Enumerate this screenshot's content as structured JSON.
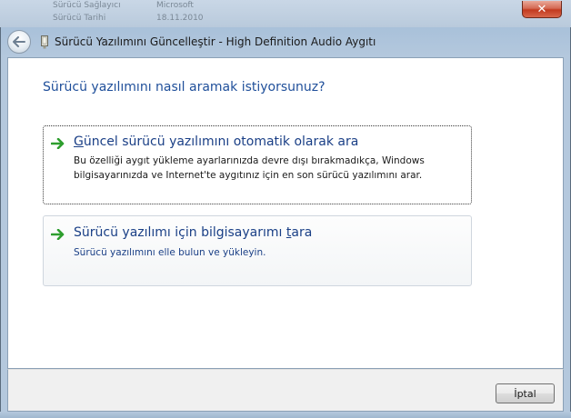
{
  "window": {
    "title": "Sürücü Yazılımını Güncelleştir - High Definition Audio Aygıtı",
    "close_symbol": "✕"
  },
  "background_window": {
    "rows": [
      {
        "label": "Sürücü Sağlayıcı",
        "value": "Microsoft"
      },
      {
        "label": "Sürücü Tarihi",
        "value": "18.11.2010"
      }
    ]
  },
  "main": {
    "heading": "Sürücü yazılımını nasıl aramak istiyorsunuz?",
    "options": [
      {
        "title_before": "",
        "title_accel": "G",
        "title_after": "üncel sürücü yazılımını otomatik olarak ara",
        "description": "Bu özelliği aygıt yükleme ayarlarınızda devre dışı bırakmadıkça, Windows bilgisayarınızda ve Internet'te aygıtınız için en son sürücü yazılımını arar."
      },
      {
        "title_before": "Sürücü yazılımı için bilgisayarımı ",
        "title_accel": "t",
        "title_after": "ara",
        "description": "Sürücü yazılımını elle bulun ve yükleyin."
      }
    ]
  },
  "footer": {
    "cancel_label": "İptal"
  },
  "icons": {
    "back": "back-arrow-icon",
    "device": "device-icon",
    "option_arrow": "green-arrow-icon",
    "close": "close-icon"
  },
  "colors": {
    "heading": "#1f4f9a",
    "option_title": "#1a3f86",
    "arrow_green": "#2e9e2e",
    "close_red": "#c23a1f"
  }
}
